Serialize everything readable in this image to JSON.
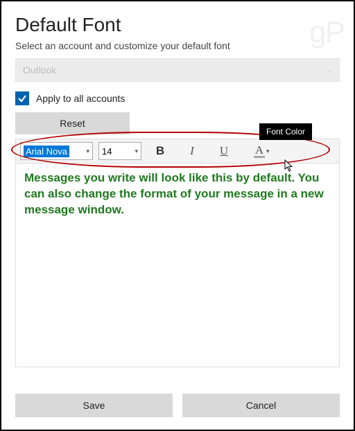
{
  "watermark": "gP",
  "header": {
    "title": "Default Font",
    "subtitle": "Select an account and customize your default font"
  },
  "account": {
    "selected": "Outlook"
  },
  "apply": {
    "label": "Apply to all accounts",
    "checked": true
  },
  "buttons": {
    "reset": "Reset",
    "save": "Save",
    "cancel": "Cancel"
  },
  "toolbar": {
    "font_name": "Arial Nova",
    "font_size": "14",
    "bold": "B",
    "italic": "I",
    "underline": "U",
    "font_color_label": "A",
    "tooltip": "Font Color"
  },
  "preview": {
    "text": "Messages you write will look like this by default. You can also change the format of your message in a new message window."
  }
}
